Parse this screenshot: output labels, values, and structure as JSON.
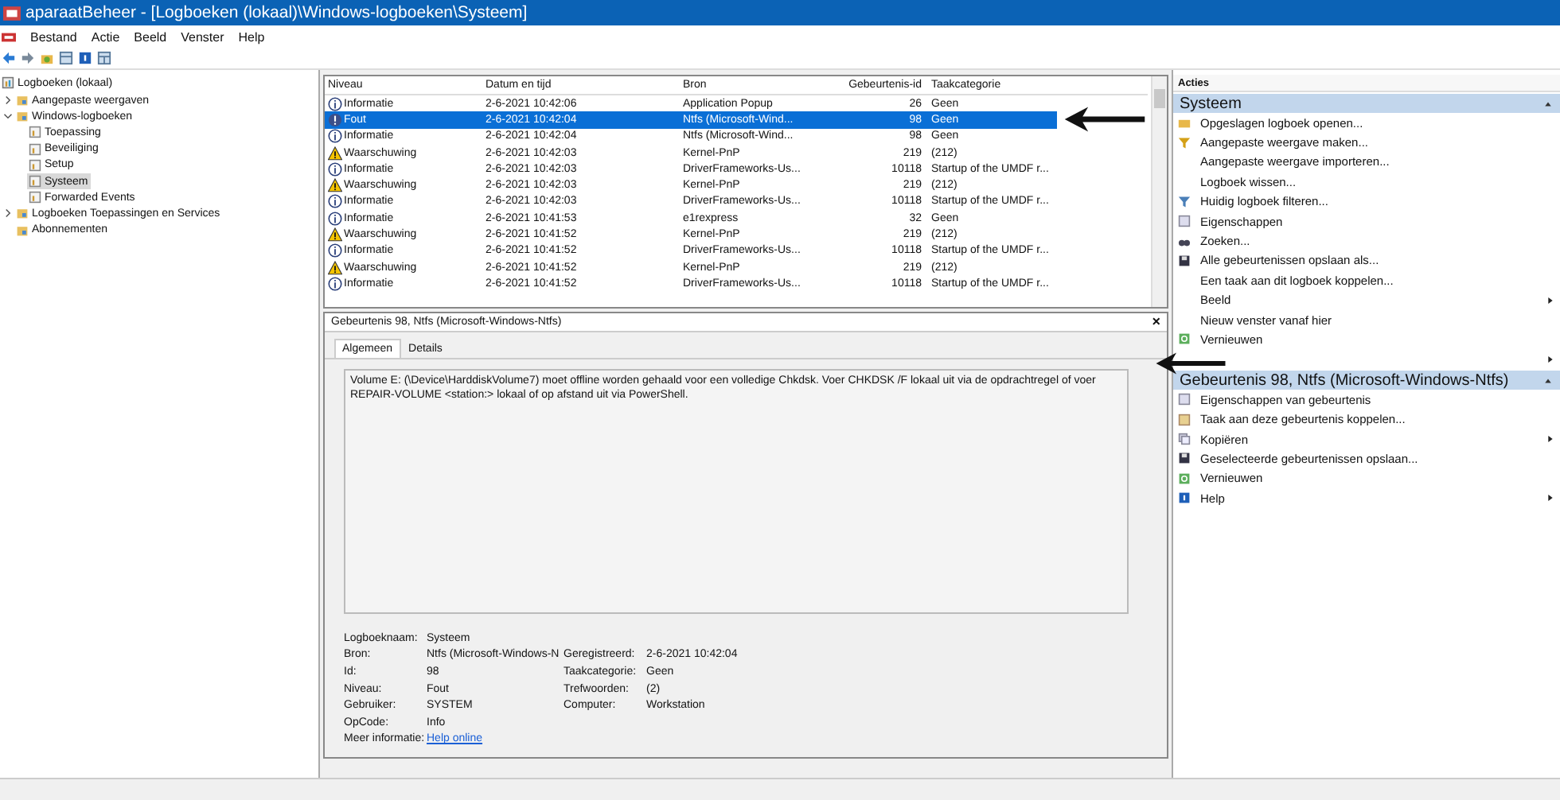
{
  "window": {
    "title": "aparaatBeheer - [Logboeken (lokaal)\\Windows-logboeken\\Systeem]"
  },
  "menu": [
    "Bestand",
    "Actie",
    "Beeld",
    "Venster",
    "Help"
  ],
  "tree": [
    {
      "label": "Logboeken (lokaal)",
      "selected": false,
      "children": [
        {
          "label": "Aangepaste weergaven",
          "expanded": false,
          "selected": false
        },
        {
          "label": "Windows-logboeken",
          "expanded": true,
          "selected": false,
          "children": [
            {
              "label": "Toepassing",
              "selected": false
            },
            {
              "label": "Beveiliging",
              "selected": false
            },
            {
              "label": "Setup",
              "selected": false
            },
            {
              "label": "Systeem",
              "selected": true
            },
            {
              "label": "Forwarded Events",
              "selected": false
            }
          ]
        },
        {
          "label": "Logboeken Toepassingen en Services",
          "expanded": false,
          "selected": false
        },
        {
          "label": "Abonnementen",
          "selected": false
        }
      ]
    }
  ],
  "events": {
    "columns": [
      "Niveau",
      "Datum en tijd",
      "Bron",
      "Gebeurtenis-id",
      "Taakcategorie"
    ],
    "rows": [
      {
        "kind": "info",
        "level": "Informatie",
        "date": "2-6-2021 10:42:06",
        "source": "Application Popup",
        "id": "26",
        "category": "Geen",
        "selected": false
      },
      {
        "kind": "error",
        "level": "Fout",
        "date": "2-6-2021 10:42:04",
        "source": "Ntfs (Microsoft-Wind...",
        "id": "98",
        "category": "Geen",
        "selected": true
      },
      {
        "kind": "info",
        "level": "Informatie",
        "date": "2-6-2021 10:42:04",
        "source": "Ntfs (Microsoft-Wind...",
        "id": "98",
        "category": "Geen",
        "selected": false
      },
      {
        "kind": "warning",
        "level": "Waarschuwing",
        "date": "2-6-2021 10:42:03",
        "source": "Kernel-PnP",
        "id": "219",
        "category": "(212)",
        "selected": false
      },
      {
        "kind": "info",
        "level": "Informatie",
        "date": "2-6-2021 10:42:03",
        "source": "DriverFrameworks-Us...",
        "id": "10118",
        "category": "Startup of the UMDF r...",
        "selected": false
      },
      {
        "kind": "warning",
        "level": "Waarschuwing",
        "date": "2-6-2021 10:42:03",
        "source": "Kernel-PnP",
        "id": "219",
        "category": "(212)",
        "selected": false
      },
      {
        "kind": "info",
        "level": "Informatie",
        "date": "2-6-2021 10:42:03",
        "source": "DriverFrameworks-Us...",
        "id": "10118",
        "category": "Startup of the UMDF r...",
        "selected": false
      },
      {
        "kind": "info",
        "level": "Informatie",
        "date": "2-6-2021 10:41:53",
        "source": "e1rexpress",
        "id": "32",
        "category": "Geen",
        "selected": false
      },
      {
        "kind": "warning",
        "level": "Waarschuwing",
        "date": "2-6-2021 10:41:52",
        "source": "Kernel-PnP",
        "id": "219",
        "category": "(212)",
        "selected": false
      },
      {
        "kind": "info",
        "level": "Informatie",
        "date": "2-6-2021 10:41:52",
        "source": "DriverFrameworks-Us...",
        "id": "10118",
        "category": "Startup of the UMDF r...",
        "selected": false
      },
      {
        "kind": "warning",
        "level": "Waarschuwing",
        "date": "2-6-2021 10:41:52",
        "source": "Kernel-PnP",
        "id": "219",
        "category": "(212)",
        "selected": false
      },
      {
        "kind": "info",
        "level": "Informatie",
        "date": "2-6-2021 10:41:52",
        "source": "DriverFrameworks-Us...",
        "id": "10118",
        "category": "Startup of the UMDF r...",
        "selected": false
      }
    ]
  },
  "detail": {
    "title": "Gebeurtenis 98, Ntfs (Microsoft-Windows-Ntfs)",
    "close": "×",
    "tabs": [
      {
        "label": "Algemeen",
        "selected": true
      },
      {
        "label": "Details",
        "selected": false
      }
    ],
    "message": "Volume E: (\\Device\\HarddiskVolume7) moet offline worden gehaald voor een volledige Chkdsk.  Voer CHKDSK /F lokaal uit via de opdrachtregel of voer REPAIR-VOLUME <station:> lokaal of op afstand uit via PowerShell.",
    "properties": [
      {
        "label": "Logboeknaam:",
        "value": "Systeem"
      },
      {
        "label": "Bron:",
        "value": "Ntfs (Microsoft-Windows-N",
        "label2": "Geregistreerd:",
        "value2": "2-6-2021 10:42:04"
      },
      {
        "label": "Id:",
        "value": "98",
        "label2": "Taakcategorie:",
        "value2": "Geen"
      },
      {
        "label": "Niveau:",
        "value": "Fout",
        "label2": "Trefwoorden:",
        "value2": "(2)"
      },
      {
        "label": "Gebruiker:",
        "value": "SYSTEM",
        "label2": "Computer:",
        "value2": "Workstation"
      },
      {
        "label": "OpCode:",
        "value": "Info"
      },
      {
        "label": "Meer informatie:",
        "link": "Help online"
      }
    ]
  },
  "actions": {
    "header": "Acties",
    "sections": [
      {
        "title": "Systeem",
        "expanded": true,
        "items": [
          {
            "label": "Opgeslagen logboek openen...",
            "kind": "folder"
          },
          {
            "label": "Aangepaste weergave maken...",
            "kind": "filter"
          },
          {
            "label": "Aangepaste weergave importeren..."
          },
          {
            "label": "Logboek wissen..."
          },
          {
            "label": "Huidig logboek filteren...",
            "kind": "filter2"
          },
          {
            "label": "Eigenschappen",
            "kind": "props"
          },
          {
            "label": "Zoeken...",
            "kind": "find"
          },
          {
            "label": "Alle gebeurtenissen opslaan als...",
            "kind": "save"
          },
          {
            "label": "Een taak aan dit logboek koppelen..."
          },
          {
            "label": "Beeld",
            "submenu": true
          },
          {
            "label": "Nieuw venster vanaf hier"
          },
          {
            "label": "Vernieuwen",
            "kind": "refresh"
          },
          {
            "submenu": true
          }
        ]
      },
      {
        "title": "Gebeurtenis 98, Ntfs (Microsoft-Windows-Ntfs)",
        "expanded": true,
        "items": [
          {
            "label": "Eigenschappen van gebeurtenis",
            "kind": "props"
          },
          {
            "label": "Taak aan deze gebeurtenis koppelen...",
            "kind": "task"
          },
          {
            "label": "Kopiëren",
            "kind": "copy",
            "submenu": true
          },
          {
            "label": "Geselecteerde gebeurtenissen opslaan...",
            "kind": "save"
          },
          {
            "label": "Vernieuwen",
            "kind": "refresh"
          },
          {
            "label": "Help",
            "kind": "help",
            "submenu": true
          }
        ]
      }
    ]
  }
}
